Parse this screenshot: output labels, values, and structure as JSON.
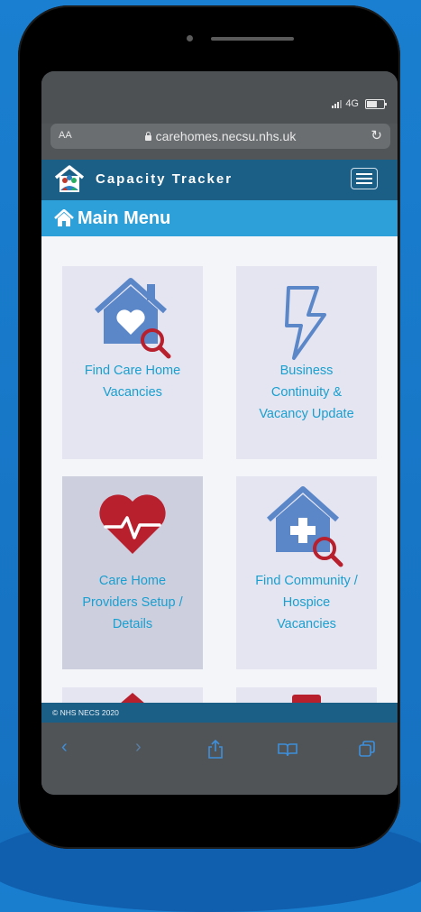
{
  "status": {
    "network": "4G"
  },
  "browser": {
    "text_size_label": "AA",
    "url": "carehomes.necsu.nhs.uk",
    "reload_icon": "reload-icon"
  },
  "header": {
    "brand": "Capacity Tracker",
    "menu_icon": "hamburger-icon"
  },
  "menu": {
    "title": "Main Menu",
    "icon": "home-icon"
  },
  "tiles": [
    {
      "label_lines": [
        "Find Care Home",
        "Vacancies"
      ],
      "icon": "house-heart-search-icon"
    },
    {
      "label_lines": [
        "Business",
        "Continuity &",
        "Vacancy Update"
      ],
      "icon": "lightning-icon"
    },
    {
      "label_lines": [
        "Care Home",
        "Providers Setup /",
        "Details"
      ],
      "icon": "heart-pulse-icon"
    },
    {
      "label_lines": [
        "Find Community /",
        "Hospice",
        "Vacancies"
      ],
      "icon": "house-cross-search-icon"
    }
  ],
  "footer": {
    "copyright": "© NHS NECS 2020"
  },
  "toolbar": {
    "back_icon": "chevron-left-icon",
    "forward_icon": "chevron-right-icon",
    "share_icon": "share-icon",
    "bookmarks_icon": "book-icon",
    "tabs_icon": "tabs-icon"
  },
  "colors": {
    "background": "#1a7fd0",
    "header": "#1b5e86",
    "menu_bar": "#2d9fd9",
    "tile": "#e4e5f1",
    "tile_selected": "#cdcfdf",
    "icon_blue": "#5b87c9",
    "icon_red": "#b8202e",
    "label": "#1a9fcf"
  }
}
